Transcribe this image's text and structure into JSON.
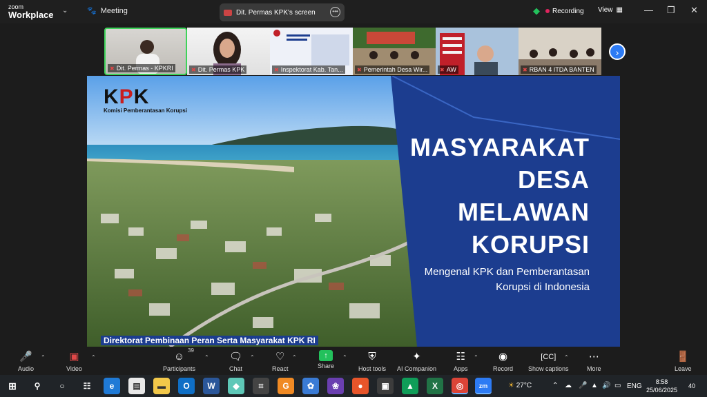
{
  "app": {
    "brand_line1": "zoom",
    "brand_line2": "Workplace"
  },
  "titlebar": {
    "meeting_label": "Meeting",
    "share_tab_label": "Dit. Permas KPK's screen",
    "recording_label": "Recording",
    "view_label": "View"
  },
  "thumbnails": [
    {
      "name": "Dit. Permas - KPKRI"
    },
    {
      "name": "Dit. Permas KPK"
    },
    {
      "name": "Inspektorat Kab. Tan..."
    },
    {
      "name": "Pemerintah Desa Wir..."
    },
    {
      "name": "AW"
    },
    {
      "name": "RBAN 4 ITDA BANTEN"
    }
  ],
  "slide": {
    "logo_text": "KPK",
    "logo_sub": "Komisi Pemberantasan Korupsi",
    "title_lines": [
      "MASYARAKAT",
      "DESA",
      "MELAWAN",
      "KORUPSI"
    ],
    "subtitle_lines": [
      "Mengenal KPK dan Pemberantasan",
      "Korupsi di Indonesia"
    ],
    "footer": "Direktorat Pembinaan Peran Serta Masyarakat KPK RI"
  },
  "toolbar": {
    "audio": "Audio",
    "video": "Video",
    "participants": "Participants",
    "participants_count": "39",
    "chat": "Chat",
    "react": "React",
    "share": "Share",
    "host_tools": "Host tools",
    "ai_companion": "AI Companion",
    "apps": "Apps",
    "record": "Record",
    "captions": "Show captions",
    "more": "More",
    "leave": "Leave"
  },
  "taskbar": {
    "weather": "27°C",
    "lang": "ENG",
    "time": "8:58",
    "date": "25/06/2025",
    "notifications": "40"
  },
  "colors": {
    "accent_green": "#3ed35a",
    "slide_blue": "#1c3d8f",
    "zoom_blue": "#2d7bf4",
    "record_red": "#e0245e"
  }
}
